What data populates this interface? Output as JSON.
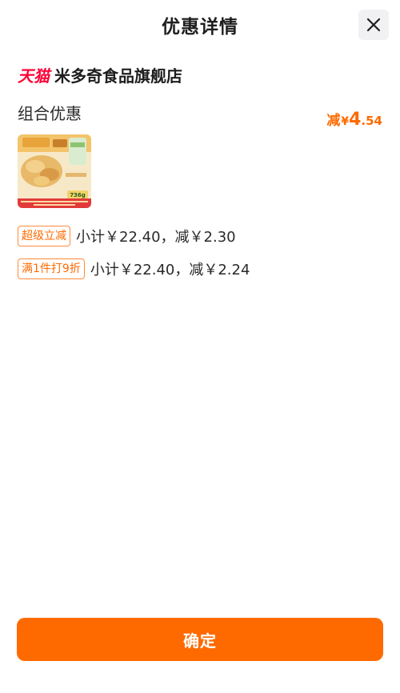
{
  "header": {
    "title": "优惠详情",
    "close_icon": "close-icon"
  },
  "store": {
    "platform_logo": "天猫",
    "name": "米多奇食品旗舰店"
  },
  "combo": {
    "label": "组合优惠",
    "discount_prefix": "减",
    "currency": "¥",
    "discount_int": "4",
    "discount_dec": ".54"
  },
  "product": {
    "image_icon": "snack-product-image",
    "weight_label": "736g"
  },
  "promotions": [
    {
      "tag": "超级立减",
      "text": "小计￥22.40，减￥2.30"
    },
    {
      "tag": "满1件打9折",
      "text": "小计￥22.40，减￥2.24"
    }
  ],
  "footer": {
    "confirm_label": "确定"
  },
  "colors": {
    "accent": "#ff6a00",
    "tmall_red": "#ff0036"
  }
}
